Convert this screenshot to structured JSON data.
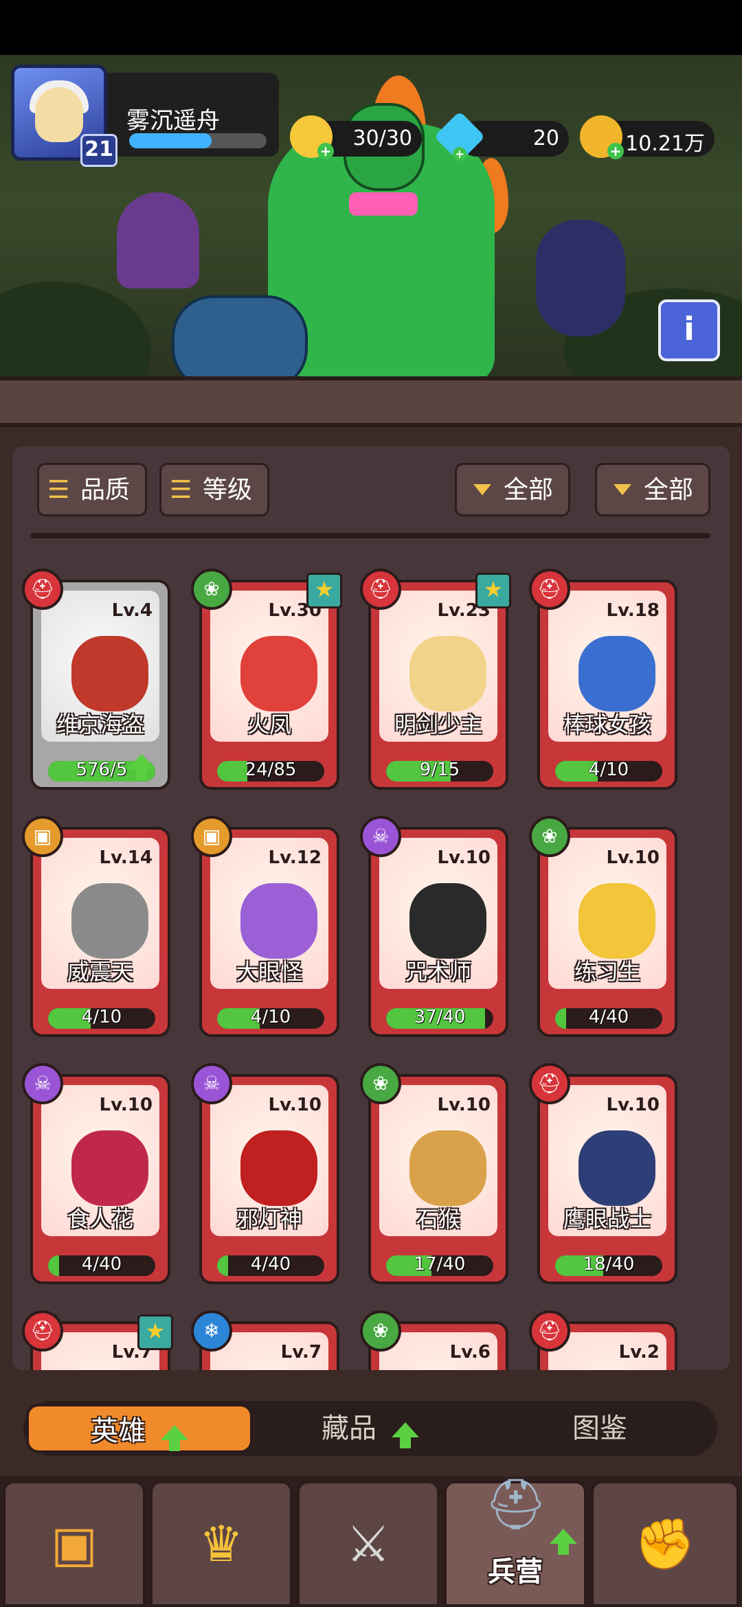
{
  "player": {
    "name": "雾沉遥舟",
    "level": "21",
    "xp_progress": 0.6
  },
  "resources": {
    "energy": {
      "value": "30/30",
      "icon": "lightning-bolt-icon",
      "color": "#f5c83a"
    },
    "gems": {
      "value": "20",
      "icon": "diamond-icon",
      "color": "#3fc6f5"
    },
    "gold": {
      "value": "10.21万",
      "icon": "gold-coin-icon",
      "color": "#f0b52a"
    }
  },
  "filters": {
    "sort_quality": "品质",
    "sort_level": "等级",
    "filter_a": "全部",
    "filter_b": "全部"
  },
  "heroes": [
    {
      "name": "维京海盗",
      "level": "Lv.4",
      "progress": "576/5",
      "fill": 1.0,
      "faction": "helmet",
      "star": false,
      "grey": true,
      "upgrade": true,
      "color": "#c0392b"
    },
    {
      "name": "火凤",
      "level": "Lv.30",
      "progress": "24/85",
      "fill": 0.28,
      "faction": "paw",
      "star": true,
      "grey": false,
      "upgrade": false,
      "color": "#e0413a"
    },
    {
      "name": "明剑少主",
      "level": "Lv.23",
      "progress": "9/15",
      "fill": 0.6,
      "faction": "helmet",
      "star": true,
      "grey": false,
      "upgrade": false,
      "color": "#f2d38a"
    },
    {
      "name": "棒球女孩",
      "level": "Lv.18",
      "progress": "4/10",
      "fill": 0.4,
      "faction": "helmet",
      "star": false,
      "grey": false,
      "upgrade": false,
      "color": "#3a6fd1"
    },
    {
      "name": "威震天",
      "level": "Lv.14",
      "progress": "4/10",
      "fill": 0.4,
      "faction": "robot",
      "star": false,
      "grey": false,
      "upgrade": false,
      "color": "#8a8a8a"
    },
    {
      "name": "大眼怪",
      "level": "Lv.12",
      "progress": "4/10",
      "fill": 0.4,
      "faction": "robot",
      "star": false,
      "grey": false,
      "upgrade": false,
      "color": "#9b5fd6"
    },
    {
      "name": "咒术师",
      "level": "Lv.10",
      "progress": "37/40",
      "fill": 0.92,
      "faction": "skull",
      "star": false,
      "grey": false,
      "upgrade": false,
      "color": "#2a2a2a"
    },
    {
      "name": "练习生",
      "level": "Lv.10",
      "progress": "4/40",
      "fill": 0.1,
      "faction": "paw",
      "star": false,
      "grey": false,
      "upgrade": false,
      "color": "#f2c53a"
    },
    {
      "name": "食人花",
      "level": "Lv.10",
      "progress": "4/40",
      "fill": 0.1,
      "faction": "skull",
      "star": false,
      "grey": false,
      "upgrade": false,
      "color": "#c0284a"
    },
    {
      "name": "邪灯神",
      "level": "Lv.10",
      "progress": "4/40",
      "fill": 0.1,
      "faction": "skull",
      "star": false,
      "grey": false,
      "upgrade": false,
      "color": "#c0201f"
    },
    {
      "name": "石猴",
      "level": "Lv.10",
      "progress": "17/40",
      "fill": 0.42,
      "faction": "paw",
      "star": false,
      "grey": false,
      "upgrade": false,
      "color": "#d9a14a"
    },
    {
      "name": "鹰眼战士",
      "level": "Lv.10",
      "progress": "18/40",
      "fill": 0.45,
      "faction": "helmet",
      "star": false,
      "grey": false,
      "upgrade": false,
      "color": "#2e3f77"
    },
    {
      "name": "",
      "level": "Lv.7",
      "progress": "",
      "fill": 0,
      "faction": "helmet",
      "star": true,
      "grey": false,
      "upgrade": false,
      "color": "#c7373a"
    },
    {
      "name": "",
      "level": "Lv.7",
      "progress": "",
      "fill": 0,
      "faction": "snowflake",
      "star": false,
      "grey": false,
      "upgrade": false,
      "color": "#d9ecf5"
    },
    {
      "name": "",
      "level": "Lv.6",
      "progress": "",
      "fill": 0,
      "faction": "paw",
      "star": false,
      "grey": false,
      "upgrade": false,
      "color": "#c7373a"
    },
    {
      "name": "",
      "level": "Lv.2",
      "progress": "",
      "fill": 0,
      "faction": "helmet",
      "star": false,
      "grey": false,
      "upgrade": false,
      "color": "#c7373a"
    }
  ],
  "faction_colors": {
    "helmet": "#d8343b",
    "paw": "#48a842",
    "robot": "#e59a2c",
    "skull": "#9a55d6",
    "snowflake": "#2c86d8"
  },
  "subtabs": [
    {
      "label": "英雄",
      "active": true,
      "badge": true
    },
    {
      "label": "藏品",
      "active": false,
      "badge": true
    },
    {
      "label": "图鉴",
      "active": false,
      "badge": false
    }
  ],
  "bottom_nav": [
    {
      "icon": "treasure-chest-icon",
      "label": "",
      "glyph": "▣"
    },
    {
      "icon": "crown-icon",
      "label": "",
      "glyph": "♛"
    },
    {
      "icon": "crossed-swords-icon",
      "label": "",
      "glyph": "⚔"
    },
    {
      "icon": "knight-helmet-icon",
      "label": "兵营",
      "glyph": "⛑",
      "active": true
    },
    {
      "icon": "fist-icon",
      "label": "",
      "glyph": "✊"
    }
  ]
}
